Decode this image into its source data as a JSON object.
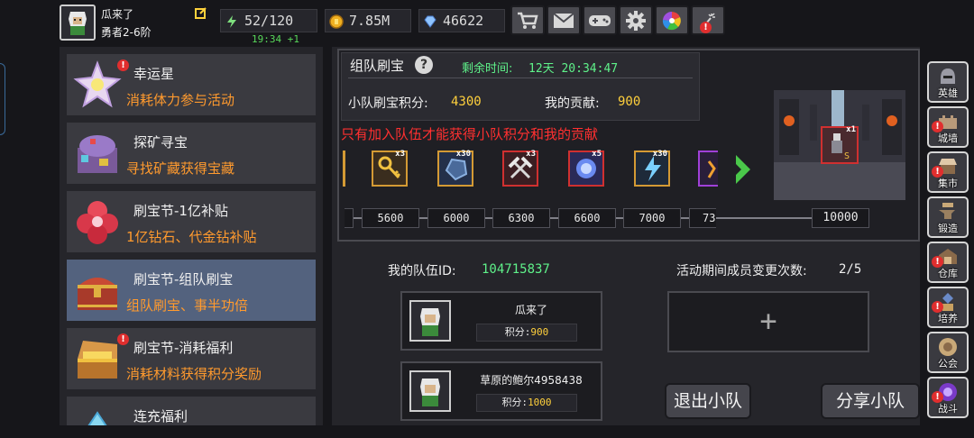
{
  "player": {
    "name": "瓜来了",
    "title": "勇者2-6阶"
  },
  "resources": {
    "energy": "52/120",
    "energy_regen": "19:34 +1",
    "gold": "7.85M",
    "diamonds": "46622"
  },
  "top_buttons": [
    "shop-cart-icon",
    "mail-icon",
    "gamepad-icon",
    "settings-gear-icon",
    "color-wheel-icon",
    "fireworks-icon"
  ],
  "left_menu": [
    {
      "title": "幸运星",
      "subtitle": "消耗体力参与活动",
      "icon": "lucky-star-icon",
      "alert": true
    },
    {
      "title": "探矿寻宝",
      "subtitle": "寻找矿藏获得宝藏",
      "icon": "mine-chest-icon",
      "alert": false
    },
    {
      "title": "刷宝节-1亿补贴",
      "subtitle": "1亿钻石、代金钻补贴",
      "icon": "red-flower-icon",
      "alert": false
    },
    {
      "title": "刷宝节-组队刷宝",
      "subtitle": "组队刷宝、事半功倍",
      "icon": "treasure-chest-icon",
      "alert": false,
      "selected": true
    },
    {
      "title": "刷宝节-消耗福利",
      "subtitle": "消耗材料获得积分奖励",
      "icon": "open-chest-icon",
      "alert": true
    },
    {
      "title": "连充福利",
      "subtitle": "",
      "icon": "crystal-icon",
      "alert": false
    }
  ],
  "event": {
    "title": "组队刷宝",
    "time_label": "剩余时间:",
    "time_value": "12天 20:34:47",
    "team_score_label": "小队刷宝积分:",
    "team_score": "4300",
    "my_contrib_label": "我的贡献:",
    "my_contrib": "900",
    "warning": "只有加入队伍才能获得小队积分和我的贡献",
    "rewards": [
      {
        "icon": "golden-key-icon",
        "count": "x3"
      },
      {
        "icon": "blue-ore-icon",
        "count": "x30"
      },
      {
        "icon": "pickaxes-icon",
        "count": "x3"
      },
      {
        "icon": "blue-gem-icon",
        "count": "x5"
      },
      {
        "icon": "lightning-icon",
        "count": "x30"
      },
      {
        "icon": "purple-item-icon",
        "count": ""
      }
    ],
    "milestones": [
      "5600",
      "6000",
      "6300",
      "6600",
      "7000",
      "73",
      "10000"
    ],
    "big_reward_count": "x1"
  },
  "team": {
    "id_label": "我的队伍ID:",
    "id_value": "104715837",
    "changes_label": "活动期间成员变更次数:",
    "changes_value": "2/5",
    "score_label": "积分:",
    "members": [
      {
        "name": "瓜来了",
        "score": "900"
      },
      {
        "name": "草原的鲍尔4958438",
        "score": "1000"
      }
    ],
    "add_slot": "+",
    "leave_button": "退出小队",
    "share_button": "分享小队"
  },
  "right_nav": [
    {
      "label": "英雄",
      "icon": "hero-helmet-icon",
      "alert": false
    },
    {
      "label": "城墙",
      "icon": "castle-wall-icon",
      "alert": true
    },
    {
      "label": "集市",
      "icon": "market-stall-icon",
      "alert": true
    },
    {
      "label": "锻造",
      "icon": "anvil-hammer-icon",
      "alert": false
    },
    {
      "label": "仓库",
      "icon": "warehouse-icon",
      "alert": true
    },
    {
      "label": "培养",
      "icon": "training-icon",
      "alert": true
    },
    {
      "label": "公会",
      "icon": "guild-icon",
      "alert": false
    },
    {
      "label": "战斗",
      "icon": "battle-portal-icon",
      "alert": true
    }
  ],
  "colors": {
    "accent_green": "#5ff28a",
    "accent_yellow": "#ffd03c",
    "subtitle_orange": "#ff9a2e",
    "warning_red": "#ff3030",
    "selected_item": "#53627e"
  }
}
